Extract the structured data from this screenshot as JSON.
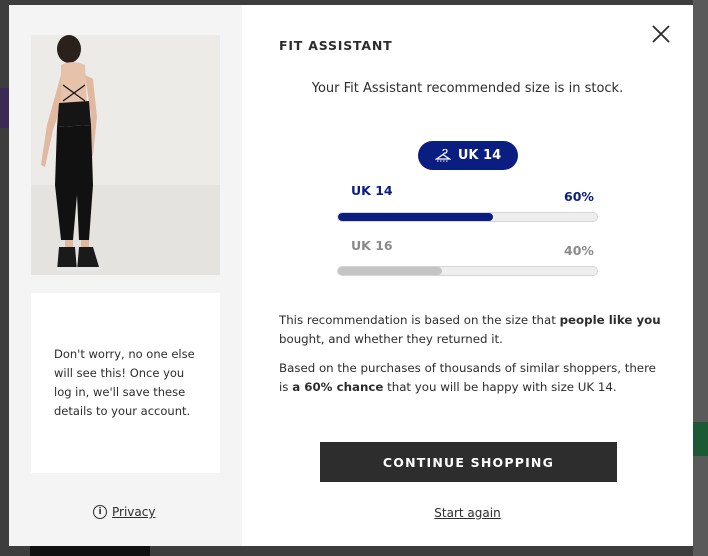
{
  "modal": {
    "title": "FIT ASSISTANT",
    "subtitle": "Your Fit Assistant recommended size is in stock.",
    "recommended_size": "UK 14",
    "sizes": [
      {
        "label": "UK 14",
        "percent_label": "60%",
        "fraction": 0.6,
        "color": "#0a1e82"
      },
      {
        "label": "UK 16",
        "percent_label": "40%",
        "fraction": 0.4,
        "color": "#c4c4c4"
      }
    ],
    "explanation1": {
      "pre": "This recommendation is based on the size that ",
      "bold": "people like you",
      "post": " bought, and whether they returned it."
    },
    "explanation2": {
      "pre": "Based on the purchases of thousands of similar shoppers, there is ",
      "bold": "a 60% chance",
      "post": " that you will be happy with size UK 14."
    },
    "cta_label": "CONTINUE SHOPPING",
    "start_again_label": "Start again"
  },
  "left_panel": {
    "note": "Don't worry, no one else will see this! Once you log in, we'll save these details to your account.",
    "privacy_label": "Privacy"
  },
  "colors": {
    "accent": "#0a1e82",
    "dark": "#2d2d2d",
    "secondary_bar": "#c4c4c4"
  }
}
